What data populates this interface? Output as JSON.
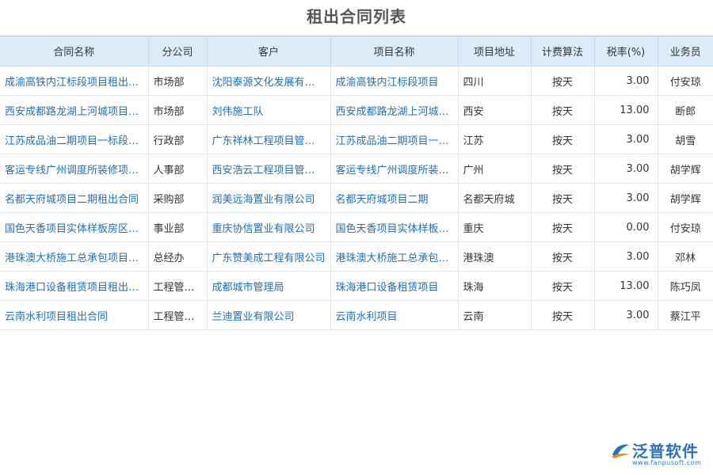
{
  "title": "租出合同列表",
  "columns": [
    "合同名称",
    "分公司",
    "客户",
    "项目名称",
    "项目地址",
    "计费算法",
    "税率(%)",
    "业务员"
  ],
  "rows": [
    [
      "成渝高铁内江标段项目租出合同",
      "市场部",
      "沈阳泰源文化发展有限公司",
      "成渝高铁内江标段项目",
      "四川",
      "按天",
      "3.00",
      "付安琼"
    ],
    [
      "西安成都路龙湖上河城项目租出合同",
      "市场部",
      "刘伟施工队",
      "西安成都路龙湖上河城项目",
      "西安",
      "按天",
      "13.00",
      "断郎"
    ],
    [
      "江苏成品油二期项目一标段租出合同",
      "行政部",
      "广东祥林工程项目管理有限公司",
      "江苏成品油二期项目一标段",
      "江苏",
      "按天",
      "3.00",
      "胡雪"
    ],
    [
      "客运专线广州调度所装修项目租出合同",
      "人事部",
      "西安浩云工程项目管理有限公司",
      "客运专线广州调度所装修项目",
      "广州",
      "按天",
      "3.00",
      "胡学辉"
    ],
    [
      "名都天府城项目二期租出合同",
      "采购部",
      "润美远海置业有限公司",
      "名都天府城项目二期",
      "名都天府城",
      "按天",
      "3.00",
      "胡学辉"
    ],
    [
      "国色天香项目实体样板房区租出合同",
      "事业部",
      "重庆协信置业有限公司",
      "国色天香项目实体样板房区",
      "重庆",
      "按天",
      "0.00",
      "付安琼"
    ],
    [
      "港珠澳大桥施工总承包项目租出合同",
      "总经办",
      "广东赞美成工程有限公司",
      "港珠澳大桥施工总承包项目",
      "港珠澳",
      "按天",
      "3.00",
      "邓林"
    ],
    [
      "珠海港口设备租赁项目租出合同",
      "工程管理部",
      "成都城市管理局",
      "珠海港口设备租赁项目",
      "珠海",
      "按天",
      "13.00",
      "陈巧凤"
    ],
    [
      "云南水利项目租出合同",
      "工程管理部",
      "兰迪置业有限公司",
      "云南水利项目",
      "云南",
      "按天",
      "3.00",
      "蔡江平"
    ]
  ],
  "watermark": {
    "brand": "泛普软件",
    "url": "www.fanpusoft.com"
  },
  "colors": {
    "header_bg": "#deecf9",
    "link": "#1f6fb2",
    "brand": "#2b73b9"
  }
}
